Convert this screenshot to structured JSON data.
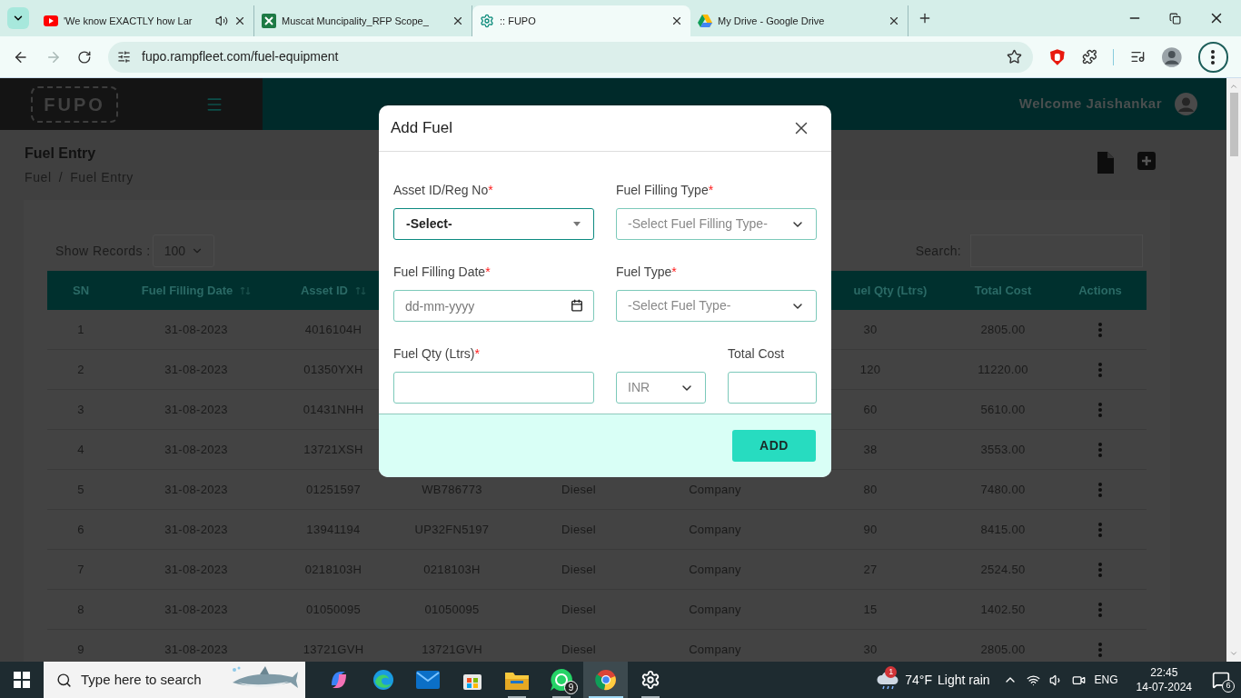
{
  "browser": {
    "tabs": [
      {
        "kind": "youtube",
        "title": "'We know EXACTLY how Lar",
        "audio": true,
        "selected": false
      },
      {
        "kind": "excel",
        "title": "Muscat Muncipality_RFP Scope_",
        "audio": false,
        "selected": false
      },
      {
        "kind": "settings",
        "title": ":: FUPO",
        "audio": false,
        "selected": true
      },
      {
        "kind": "drive",
        "title": "My Drive - Google Drive",
        "audio": false,
        "selected": false
      }
    ],
    "forward_disabled": true,
    "url": "fupo.rampfleet.com/fuel-equipment"
  },
  "app": {
    "logo": "FUPO",
    "welcome": "Welcome Jaishankar",
    "page_title": "Fuel Entry",
    "breadcrumb": [
      "Fuel",
      "Fuel Entry"
    ],
    "breadcrumb_separator": "/",
    "show_records_label": "Show Records :",
    "records_value": "100",
    "search_label": "Search:",
    "table": {
      "columns": {
        "sn": {
          "label": "SN",
          "sortable": false
        },
        "date": {
          "label": "Fuel Filling Date",
          "sortable": true
        },
        "asset_id": {
          "label": "Asset ID",
          "sortable": true
        },
        "qty": {
          "label": "uel Qty (Ltrs)",
          "sortable": false
        },
        "total_cost": {
          "label": "Total Cost",
          "sortable": false
        },
        "actions": {
          "label": "Actions",
          "sortable": false
        }
      },
      "rows": [
        {
          "sn": "1",
          "date": "31-08-2023",
          "asset_id": "4016104H",
          "qty": "30",
          "total_cost": "2805.00"
        },
        {
          "sn": "2",
          "date": "31-08-2023",
          "asset_id": "01350YXH",
          "qty": "120",
          "total_cost": "11220.00"
        },
        {
          "sn": "3",
          "date": "31-08-2023",
          "asset_id": "01431NHH",
          "qty": "60",
          "total_cost": "5610.00"
        },
        {
          "sn": "4",
          "date": "31-08-2023",
          "asset_id": "13721XSH",
          "qty": "38",
          "total_cost": "3553.00"
        },
        {
          "sn": "5",
          "date": "31-08-2023",
          "asset_id": "01251597",
          "column_4": "WB786773",
          "column_5": "Diesel",
          "column_6": "Company",
          "qty": "80",
          "total_cost": "7480.00"
        },
        {
          "sn": "6",
          "date": "31-08-2023",
          "asset_id": "13941194",
          "column_4": "UP32FN5197",
          "column_5": "Diesel",
          "column_6": "Company",
          "qty": "90",
          "total_cost": "8415.00"
        },
        {
          "sn": "7",
          "date": "31-08-2023",
          "asset_id": "0218103H",
          "column_4": "0218103H",
          "column_5": "Diesel",
          "column_6": "Company",
          "qty": "27",
          "total_cost": "2524.50"
        },
        {
          "sn": "8",
          "date": "31-08-2023",
          "asset_id": "01050095",
          "column_4": "01050095",
          "column_5": "Diesel",
          "column_6": "Company",
          "qty": "15",
          "total_cost": "1402.50"
        },
        {
          "sn": "9",
          "date": "31-08-2023",
          "asset_id": "13721GVH",
          "column_4": "13721GVH",
          "column_5": "Diesel",
          "column_6": "Company",
          "qty": "30",
          "total_cost": "2805.00"
        }
      ]
    }
  },
  "modal": {
    "title": "Add Fuel",
    "submit": "ADD",
    "fields": [
      {
        "kind": "combo",
        "label": "Asset ID/Reg No",
        "required_mark": "*",
        "value": "-Select-",
        "focused": true
      },
      {
        "kind": "select",
        "label": "Fuel Filling Type",
        "required_mark": "*",
        "placeholder": "-Select Fuel Filling Type-",
        "focused": false
      },
      {
        "kind": "date",
        "label": "Fuel Filling Date",
        "required_mark": "*",
        "placeholder": "dd-mm-yyyy",
        "focused": false
      },
      {
        "kind": "select",
        "label": "Fuel Type",
        "required_mark": "*",
        "placeholder": "-Select Fuel Type-",
        "focused": false
      },
      {
        "kind": "text",
        "label": "Fuel Qty (Ltrs)",
        "required_mark": "*",
        "focused": false
      },
      {
        "kind": "select",
        "placeholder": "INR",
        "focused": false
      },
      {
        "kind": "text",
        "label": "Total Cost",
        "focused": false
      }
    ]
  },
  "taskbar": {
    "search_placeholder": "Type here to search",
    "apps": [
      {
        "kind": "copilot",
        "running": false,
        "selected": false
      },
      {
        "kind": "edge",
        "running": false,
        "selected": false
      },
      {
        "kind": "mail",
        "running": false,
        "selected": false
      },
      {
        "kind": "store",
        "running": false,
        "selected": false
      },
      {
        "kind": "explorer",
        "running": true,
        "selected": false
      },
      {
        "kind": "whatsapp",
        "running": true,
        "selected": false,
        "badge": "9"
      },
      {
        "kind": "chrome",
        "running": true,
        "selected": true
      },
      {
        "kind": "settings",
        "running": true,
        "selected": false
      }
    ],
    "weather": {
      "temperature": "74°F",
      "condition": "Light rain",
      "badge": "1"
    },
    "language": "ENG",
    "time": "22:45",
    "date": "14-07-2024",
    "notifications": "6"
  }
}
